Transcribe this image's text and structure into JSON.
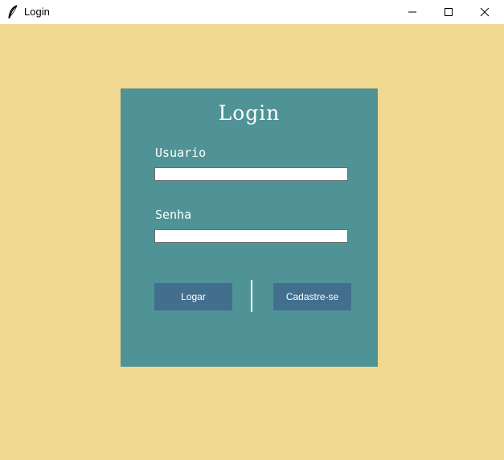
{
  "window": {
    "title": "Login",
    "icon": "feather-icon",
    "controls": [
      "minimize-icon",
      "maximize-icon",
      "close-icon"
    ]
  },
  "colors": {
    "background": "#f0d890",
    "panel": "#4f9396",
    "button": "#426f8e",
    "text": "#ffffff"
  },
  "form": {
    "title": "Login",
    "username_label": "Usuario",
    "username_value": "",
    "password_label": "Senha",
    "password_value": "",
    "login_button": "Logar",
    "register_button": "Cadastre-se"
  }
}
